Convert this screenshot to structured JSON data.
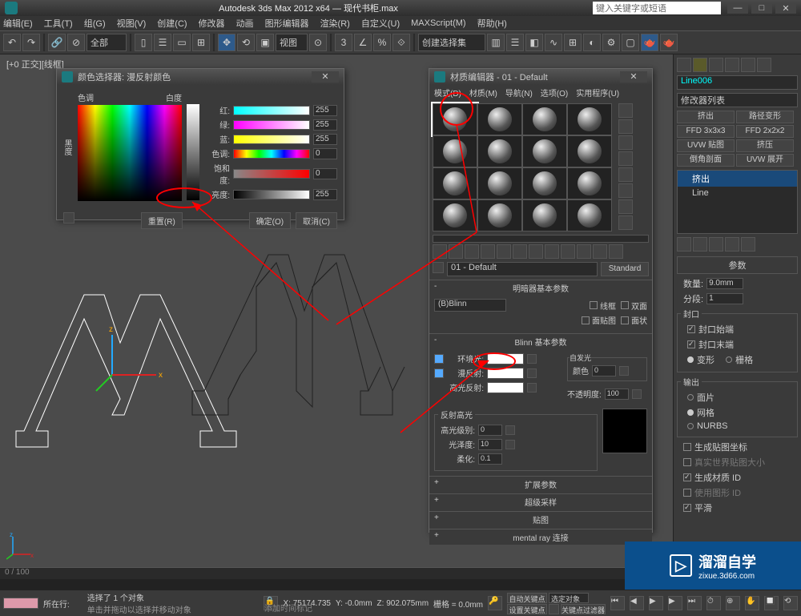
{
  "titlebar": {
    "title": "Autodesk 3ds Max  2012 x64 — 现代书柜.max",
    "search_placeholder": "键入关键字或短语"
  },
  "menubar": [
    "编辑(E)",
    "工具(T)",
    "组(G)",
    "视图(V)",
    "创建(C)",
    "修改器",
    "动画",
    "图形编辑器",
    "渲染(R)",
    "自定义(U)",
    "MAXScript(M)",
    "帮助(H)"
  ],
  "toolbar": {
    "scope": "全部",
    "selset": "创建选择集"
  },
  "viewport": {
    "label": "[+0 正交][线框]"
  },
  "colorpicker": {
    "title": "颜色选择器: 漫反射颜色",
    "hue": "色调",
    "white": "白度",
    "rows": [
      {
        "lbl": "红:",
        "val": "255"
      },
      {
        "lbl": "绿:",
        "val": "255"
      },
      {
        "lbl": "蓝:",
        "val": "255"
      },
      {
        "lbl": "色调:",
        "val": "0"
      },
      {
        "lbl": "饱和度:",
        "val": "0"
      },
      {
        "lbl": "亮度:",
        "val": "255"
      }
    ],
    "side_label": "黑度",
    "reset": "重置(R)",
    "ok": "确定(O)",
    "cancel": "取消(C)"
  },
  "material": {
    "title": "材质编辑器 - 01 - Default",
    "menu": [
      "模式(D)",
      "材质(M)",
      "导航(N)",
      "选项(O)",
      "实用程序(U)"
    ],
    "name": "01 - Default",
    "type_btn": "Standard",
    "shader_head": "明暗器基本参数",
    "shader": "(B)Blinn",
    "shader_opts": [
      "线框",
      "双面",
      "面贴图",
      "面状"
    ],
    "basic_head": "Blinn 基本参数",
    "selfillum": "自发光",
    "color_chk": "颜色",
    "selfillum_val": "0",
    "ambient": "环境光:",
    "diffuse": "漫反射:",
    "specular": "高光反射:",
    "opacity": "不透明度:",
    "opacity_val": "100",
    "spec_group": "反射高光",
    "spec_level": "高光级别:",
    "spec_level_val": "0",
    "gloss": "光泽度:",
    "gloss_val": "10",
    "soften": "柔化:",
    "soften_val": "0.1",
    "rollouts": [
      "扩展参数",
      "超级采样",
      "贴图",
      "mental ray 连接"
    ]
  },
  "rightpanel": {
    "objname": "Line006",
    "modlist": "修改器列表",
    "buttons": [
      "挤出",
      "路径变形",
      "FFD 3x3x3",
      "FFD 2x2x2",
      "UVW 贴图",
      "挤压",
      "倒角剖面",
      "UVW 展开"
    ],
    "stack": [
      "挤出",
      "Line"
    ],
    "params_head": "参数",
    "amount": "数量:",
    "amount_val": "9.0mm",
    "segs": "分段:",
    "segs_val": "1",
    "cap_group": "封口",
    "cap_start": "封口始端",
    "cap_end": "封口末端",
    "morph": "变形",
    "grid": "栅格",
    "out_group": "输出",
    "out_opts": [
      "面片",
      "网格",
      "NURBS"
    ],
    "gen_map": "生成贴图坐标",
    "real_world": "真实世界贴图大小",
    "gen_mat": "生成材质 ID",
    "use_shape": "使用图形 ID",
    "smooth": "平滑"
  },
  "status": {
    "timeline": "0 / 100",
    "sel": "选择了 1 个对象",
    "hint": "单击并拖动以选择并移动对象",
    "x": "X: 75174.735",
    "y": "Y: -0.0mm",
    "z": "Z: 902.075mm",
    "grid": "栅格 = 0.0mm",
    "autokey": "自动关键点",
    "selset": "选定对象",
    "setkey": "设置关键点",
    "keyfilter": "关键点过滤器",
    "addtime": "添加时间标记",
    "row_label": "所在行:"
  },
  "watermark": {
    "brand": "溜溜自学",
    "domain": "zixue.3d66.com"
  }
}
